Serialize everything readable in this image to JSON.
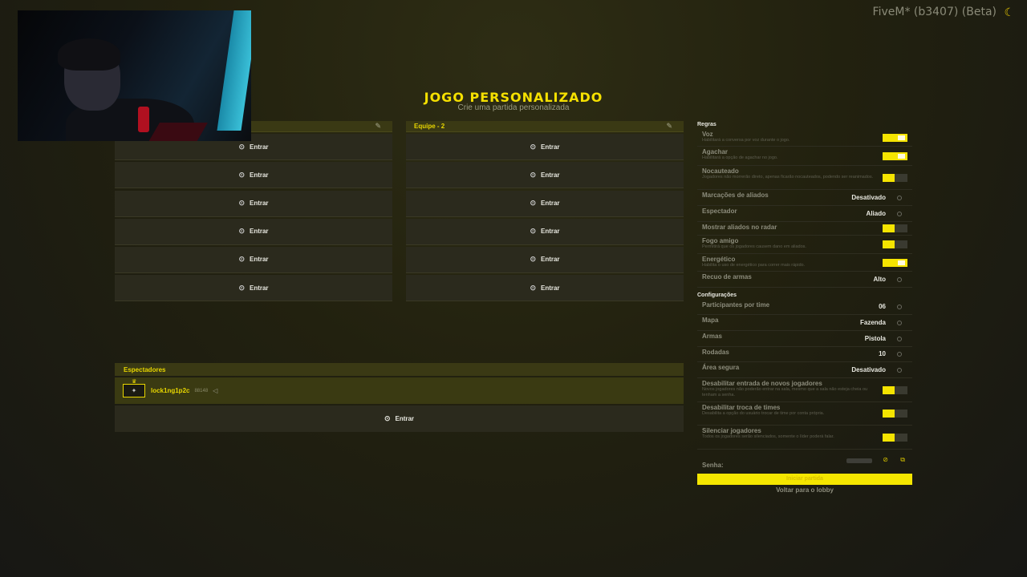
{
  "brand": "FiveM* (b3407) (Beta)",
  "brand_icon": "banana-icon",
  "title": "JOGO PERSONALIZADO",
  "subtitle": "Crie uma partida personalizada",
  "teams": [
    {
      "name": "",
      "slots": [
        "Entrar",
        "Entrar",
        "Entrar",
        "Entrar",
        "Entrar",
        "Entrar"
      ]
    },
    {
      "name": "Equipe - 2",
      "slots": [
        "Entrar",
        "Entrar",
        "Entrar",
        "Entrar",
        "Entrar",
        "Entrar"
      ]
    }
  ],
  "spectators": {
    "title": "Espectadores",
    "player": {
      "name": "lock1ng1p2c",
      "id": "88148"
    },
    "join": "Entrar"
  },
  "rules": {
    "title": "Regras",
    "voz": {
      "label": "Voz",
      "desc": "Habilitará a conversa por voz durante o jogo.",
      "state": "on"
    },
    "agachar": {
      "label": "Agachar",
      "desc": "Habilitará a opção de agachar no jogo.",
      "state": "on"
    },
    "nocauteado": {
      "label": "Nocauteado",
      "desc": "Jogadores não morrerão direto, apenas ficarão nocauteados, podendo ser reanimados.",
      "state": "off"
    },
    "marcacoes": {
      "label": "Marcações de aliados",
      "value": "Desativado"
    },
    "espectador": {
      "label": "Espectador",
      "value": "Aliado"
    },
    "radar": {
      "label": "Mostrar aliados no radar",
      "state": "off"
    },
    "fogo": {
      "label": "Fogo amigo",
      "desc": "Permitirá que os jogadores causem dano em aliados.",
      "state": "off"
    },
    "energetico": {
      "label": "Energético",
      "desc": "Habilita o uso de energético para correr mais rápido.",
      "state": "on"
    },
    "recuo": {
      "label": "Recuo de armas",
      "value": "Alto"
    }
  },
  "settings": {
    "title": "Configurações",
    "participantes": {
      "label": "Participantes por time",
      "value": "06"
    },
    "mapa": {
      "label": "Mapa",
      "value": "Fazenda"
    },
    "armas": {
      "label": "Armas",
      "value": "Pistola"
    },
    "rodadas": {
      "label": "Rodadas",
      "value": "10"
    },
    "area": {
      "label": "Área segura",
      "value": "Desativado"
    },
    "desab_entrada": {
      "label": "Desabilitar entrada de novos jogadores",
      "desc": "Novos jogadores não poderão entrar na sala, mesmo que a sala não esteja cheia ou tenham a senha.",
      "state": "off"
    },
    "desab_troca": {
      "label": "Desabilitar troca de times",
      "desc": "Desabilita a opção do usuário trocar de time por conta própria.",
      "state": "off"
    },
    "silenciar": {
      "label": "Silenciar jogadores",
      "desc": "Todos os jogadores serão silenciados, somente o líder poderá falar.",
      "state": "off"
    }
  },
  "password_label": "Senha:",
  "start_label": "Iniciar partida",
  "back_label": "Voltar para o lobby",
  "colors": {
    "accent": "#f5e400",
    "background": "#22210f"
  }
}
